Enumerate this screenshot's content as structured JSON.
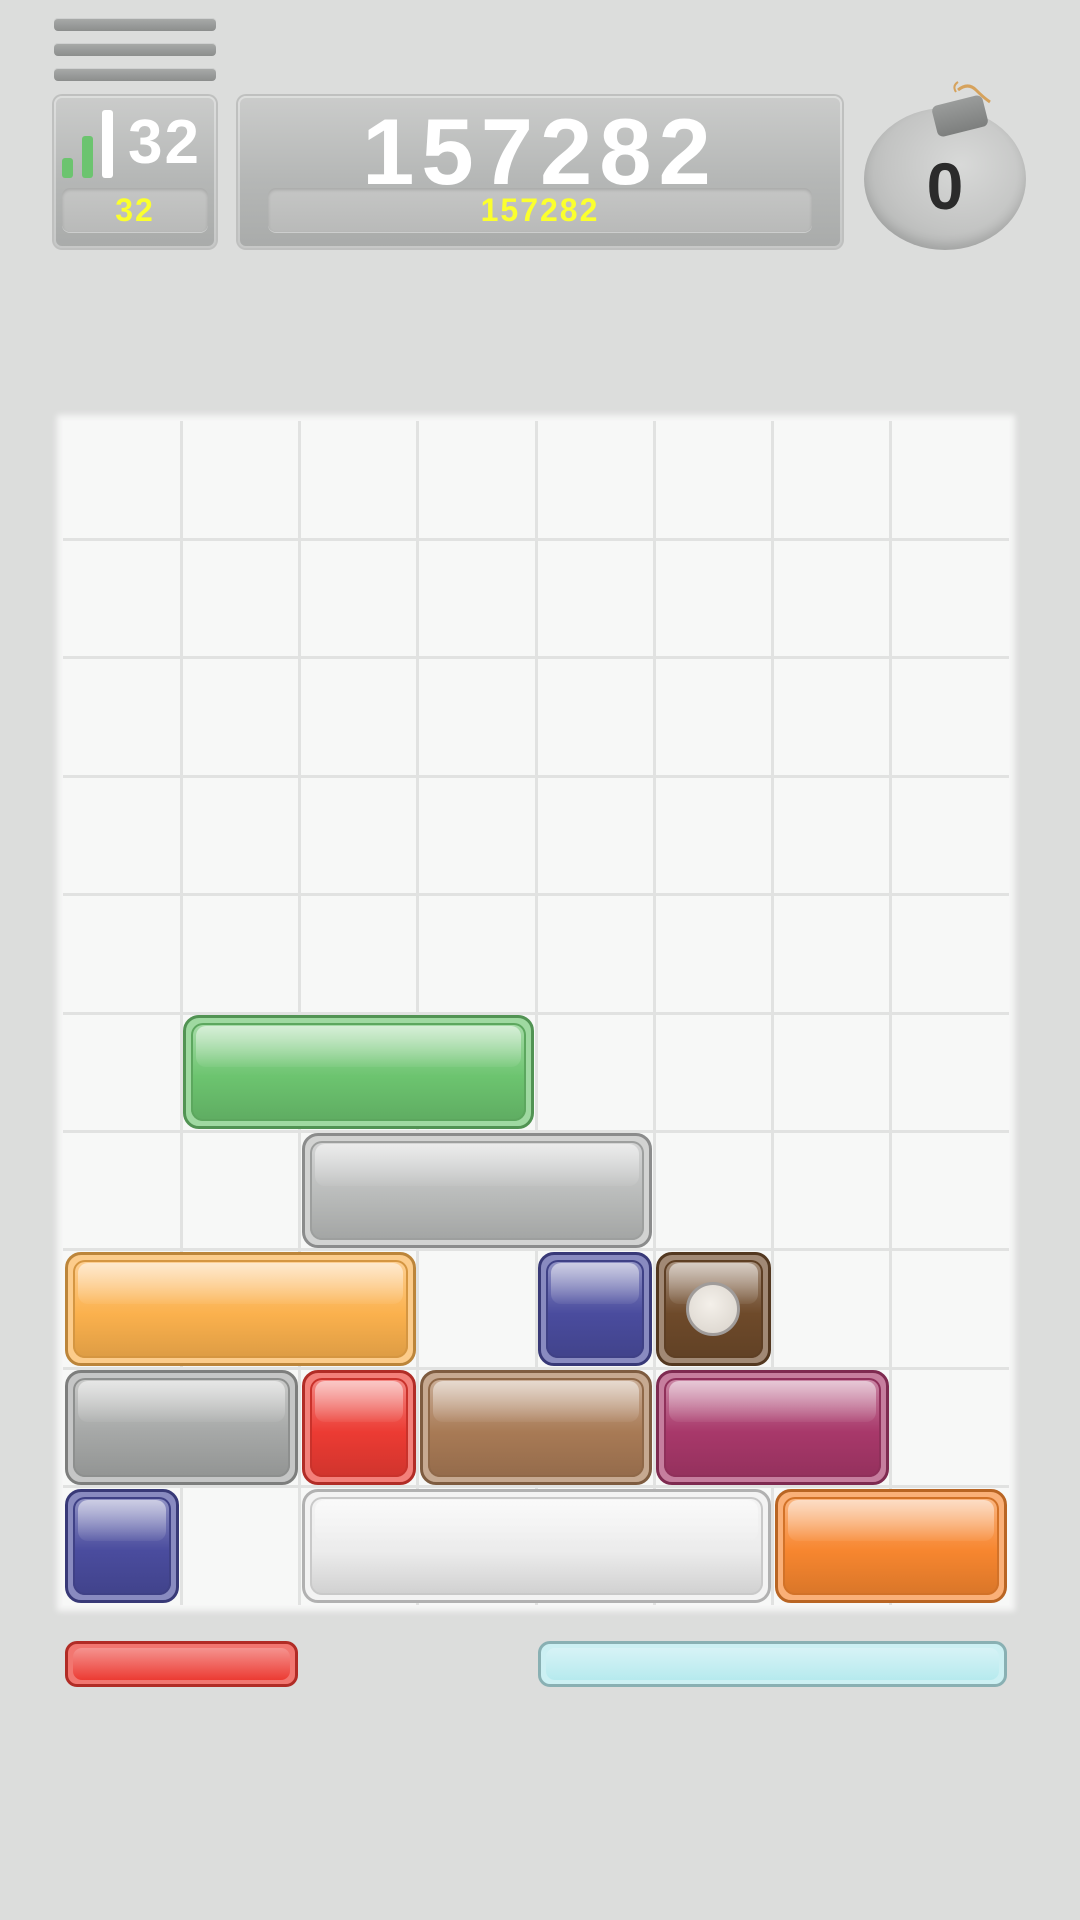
{
  "header": {
    "menu_icon": "hamburger-menu-icon",
    "level": {
      "icon": "signal-bars-icon",
      "value": "32",
      "best": "32"
    },
    "score": {
      "value": "157282",
      "best": "157282"
    },
    "bomb": {
      "icon": "bomb-icon",
      "count": "0"
    }
  },
  "colors": {
    "green": "#6cc46f",
    "silver": "#b9bbba",
    "orange_light": "#fbb14d",
    "navy": "#4a4c9e",
    "brown_dark": "#6e4a2a",
    "gray_dark": "#a6a8a7",
    "red": "#ec3b33",
    "tan": "#a87a55",
    "magenta": "#a8386a",
    "white": "#ececec",
    "orange": "#f7862f",
    "cyan": "#b6eaee",
    "yellow_text": "#fbff2e"
  },
  "board": {
    "columns": 8,
    "rows": 10,
    "blocks": [
      {
        "name": "block-green",
        "color": "green",
        "row": 5,
        "col": 1,
        "len": 3
      },
      {
        "name": "block-silver",
        "color": "silver",
        "row": 6,
        "col": 2,
        "len": 3
      },
      {
        "name": "block-light-orange",
        "color": "orange_light",
        "row": 7,
        "col": 0,
        "len": 3
      },
      {
        "name": "block-navy",
        "color": "navy",
        "row": 7,
        "col": 4,
        "len": 1
      },
      {
        "name": "block-brown-bomb",
        "color": "brown_dark",
        "row": 7,
        "col": 5,
        "len": 1,
        "bomb": true
      },
      {
        "name": "block-dark-gray",
        "color": "gray_dark",
        "row": 8,
        "col": 0,
        "len": 2
      },
      {
        "name": "block-red",
        "color": "red",
        "row": 8,
        "col": 2,
        "len": 1
      },
      {
        "name": "block-tan",
        "color": "tan",
        "row": 8,
        "col": 3,
        "len": 2
      },
      {
        "name": "block-magenta",
        "color": "magenta",
        "row": 8,
        "col": 5,
        "len": 2
      },
      {
        "name": "block-navy",
        "color": "navy",
        "row": 9,
        "col": 0,
        "len": 1
      },
      {
        "name": "block-white",
        "color": "white",
        "row": 9,
        "col": 2,
        "len": 4
      },
      {
        "name": "block-orange",
        "color": "orange",
        "row": 9,
        "col": 6,
        "len": 2
      }
    ]
  },
  "next_row": [
    {
      "name": "preview-red",
      "color": "red",
      "col": 0,
      "len": 2
    },
    {
      "name": "preview-cyan",
      "color": "cyan",
      "col": 4,
      "len": 4
    }
  ]
}
